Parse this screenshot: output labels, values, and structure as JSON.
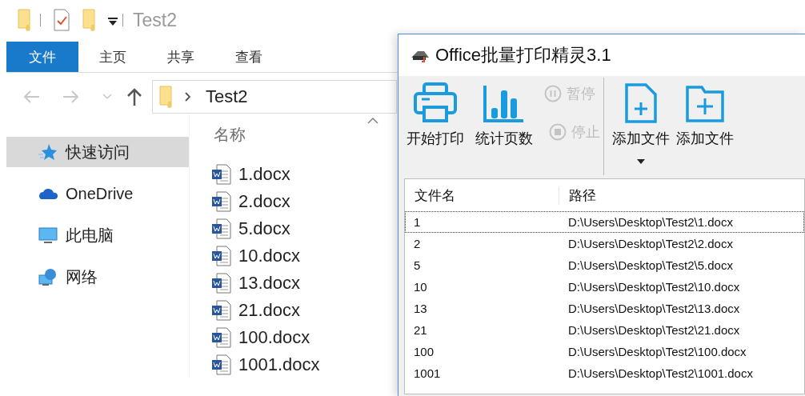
{
  "explorer": {
    "title": "Test2",
    "ribbon_tabs": [
      {
        "label": "文件",
        "selected": true
      },
      {
        "label": "主页",
        "selected": false
      },
      {
        "label": "共享",
        "selected": false
      },
      {
        "label": "查看",
        "selected": false
      }
    ],
    "address": {
      "crumb": "Test2"
    },
    "nav_pane": [
      {
        "label": "快速访问",
        "kind": "quick",
        "selected": true
      },
      {
        "label": "OneDrive",
        "kind": "cloud",
        "selected": false
      },
      {
        "label": "此电脑",
        "kind": "pc",
        "selected": false
      },
      {
        "label": "网络",
        "kind": "network",
        "selected": false
      }
    ],
    "file_list": {
      "column": "名称",
      "files": [
        "1.docx",
        "2.docx",
        "5.docx",
        "10.docx",
        "13.docx",
        "21.docx",
        "100.docx",
        "1001.docx"
      ]
    }
  },
  "app": {
    "title": "Office批量打印精灵3.1",
    "toolbar": [
      {
        "label": "开始打印",
        "kind": "print",
        "disabled": false,
        "has_menu": false
      },
      {
        "label": "统计页数",
        "kind": "stats",
        "disabled": false,
        "has_menu": false
      },
      {
        "label": "暂停",
        "kind": "pause",
        "disabled": true,
        "has_menu": false
      },
      {
        "label": "停止",
        "kind": "stop",
        "disabled": true,
        "has_menu": false
      },
      {
        "label": "添加文件",
        "kind": "add-file",
        "disabled": false,
        "has_menu": true
      },
      {
        "label": "添加文件",
        "kind": "add-folder",
        "disabled": false,
        "has_menu": false
      }
    ],
    "table": {
      "columns": [
        "文件名",
        "路径"
      ],
      "rows": [
        {
          "name": "1",
          "path": "D:\\Users\\Desktop\\Test2\\1.docx",
          "focused": true
        },
        {
          "name": "2",
          "path": "D:\\Users\\Desktop\\Test2\\2.docx",
          "focused": false
        },
        {
          "name": "5",
          "path": "D:\\Users\\Desktop\\Test2\\5.docx",
          "focused": false
        },
        {
          "name": "10",
          "path": "D:\\Users\\Desktop\\Test2\\10.docx",
          "focused": false
        },
        {
          "name": "13",
          "path": "D:\\Users\\Desktop\\Test2\\13.docx",
          "focused": false
        },
        {
          "name": "21",
          "path": "D:\\Users\\Desktop\\Test2\\21.docx",
          "focused": false
        },
        {
          "name": "100",
          "path": "D:\\Users\\Desktop\\Test2\\100.docx",
          "focused": false
        },
        {
          "name": "1001",
          "path": "D:\\Users\\Desktop\\Test2\\1001.docx",
          "focused": false
        }
      ]
    }
  }
}
